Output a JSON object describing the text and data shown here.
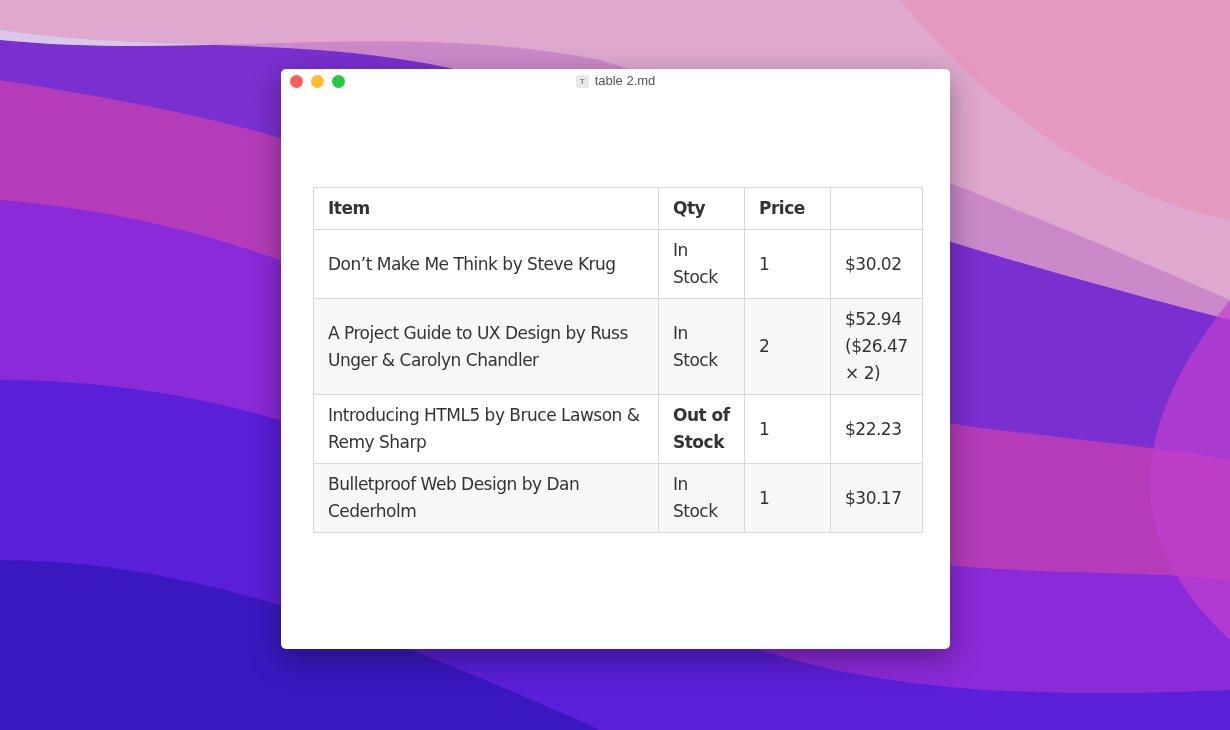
{
  "window": {
    "title": "table 2.md",
    "title_icon_letter": "T"
  },
  "table": {
    "columns": [
      "Item",
      "Qty",
      "Price",
      null
    ],
    "rows": [
      {
        "cells": [
          {
            "text": "Don’t Make Me Think by Steve Krug",
            "bold": false
          },
          {
            "text": "In Stock",
            "bold": false
          },
          {
            "text": "1",
            "bold": false
          },
          {
            "text": "$30.02",
            "bold": false
          }
        ]
      },
      {
        "cells": [
          {
            "text": "A Project Guide to UX Design by Russ Unger & Carolyn Chandler",
            "bold": false
          },
          {
            "text": "In Stock",
            "bold": false
          },
          {
            "text": "2",
            "bold": false
          },
          {
            "text": "$52.94 ($26.47 × 2)",
            "bold": false
          }
        ]
      },
      {
        "cells": [
          {
            "text": "Introducing HTML5 by Bruce Lawson & Remy Sharp",
            "bold": false
          },
          {
            "text": "Out of Stock",
            "bold": true
          },
          {
            "text": "1",
            "bold": false
          },
          {
            "text": "$22.23",
            "bold": false
          }
        ]
      },
      {
        "cells": [
          {
            "text": "Bulletproof Web Design by Dan Cederholm",
            "bold": false
          },
          {
            "text": "In Stock",
            "bold": false
          },
          {
            "text": "1",
            "bold": false
          },
          {
            "text": "$30.17",
            "bold": false
          }
        ]
      }
    ]
  }
}
